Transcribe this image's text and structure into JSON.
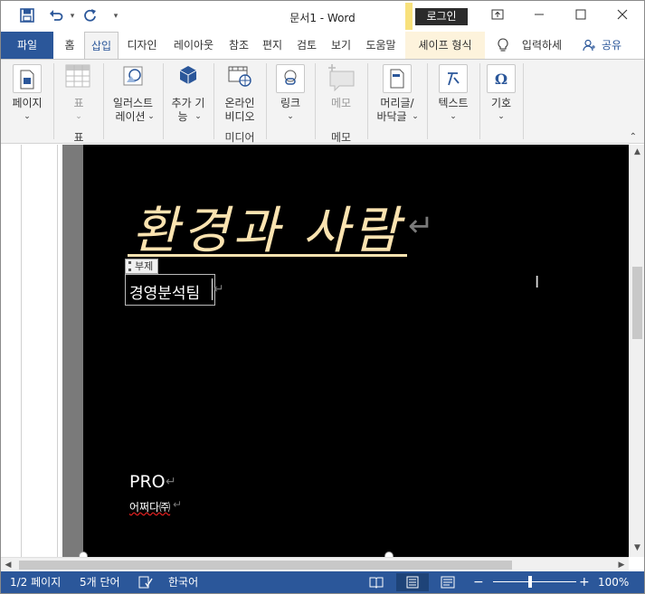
{
  "window": {
    "title": "문서1  -  Word",
    "login_label": "로그인"
  },
  "qat": {
    "save_icon": "floppy-save-icon",
    "undo_icon": "undo-arrow-icon",
    "redo_icon": "redo-circle-icon",
    "customize_icon": "customize-qat-icon"
  },
  "tabs": [
    {
      "label": "파일"
    },
    {
      "label": "홈"
    },
    {
      "label": "삽입"
    },
    {
      "label": "디자인"
    },
    {
      "label": "레이아웃"
    },
    {
      "label": "참조"
    },
    {
      "label": "편지"
    },
    {
      "label": "검토"
    },
    {
      "label": "보기"
    },
    {
      "label": "도움말"
    },
    {
      "label": "셰이프 형식"
    }
  ],
  "tell_me": {
    "label": "입력하세"
  },
  "share": {
    "label": "공유"
  },
  "ribbon": {
    "page": {
      "label": "페이지"
    },
    "table": {
      "label": "표",
      "group": "표"
    },
    "illustrations": {
      "label_line1": "일러스트",
      "label_line2": "레이션"
    },
    "addins": {
      "label_line1": "추가 기",
      "label_line2": "능"
    },
    "online_video": {
      "label_line1": "온라인",
      "label_line2": "비디오",
      "group": "미디어"
    },
    "link": {
      "label": "링크"
    },
    "comment": {
      "label": "메모",
      "group": "메모"
    },
    "header_footer": {
      "label_line1": "머리글/",
      "label_line2": "바닥글"
    },
    "text": {
      "label": "텍스트"
    },
    "symbol": {
      "label": "기호"
    }
  },
  "document": {
    "title": "환경과 사람",
    "subtitle_tag": "부제",
    "subtitle": "경영분석팀",
    "line1": "PRO",
    "line2": "어쩌다㈜",
    "return_mark": "↵"
  },
  "statusbar": {
    "page": "1/2 페이지",
    "words": "5개 단어",
    "language": "한국어",
    "zoom": "100%",
    "zoom_minus": "−",
    "zoom_plus": "+"
  },
  "colors": {
    "brand": "#2b579a",
    "title_text": "#fbe3b0",
    "page_background": "#000000"
  }
}
